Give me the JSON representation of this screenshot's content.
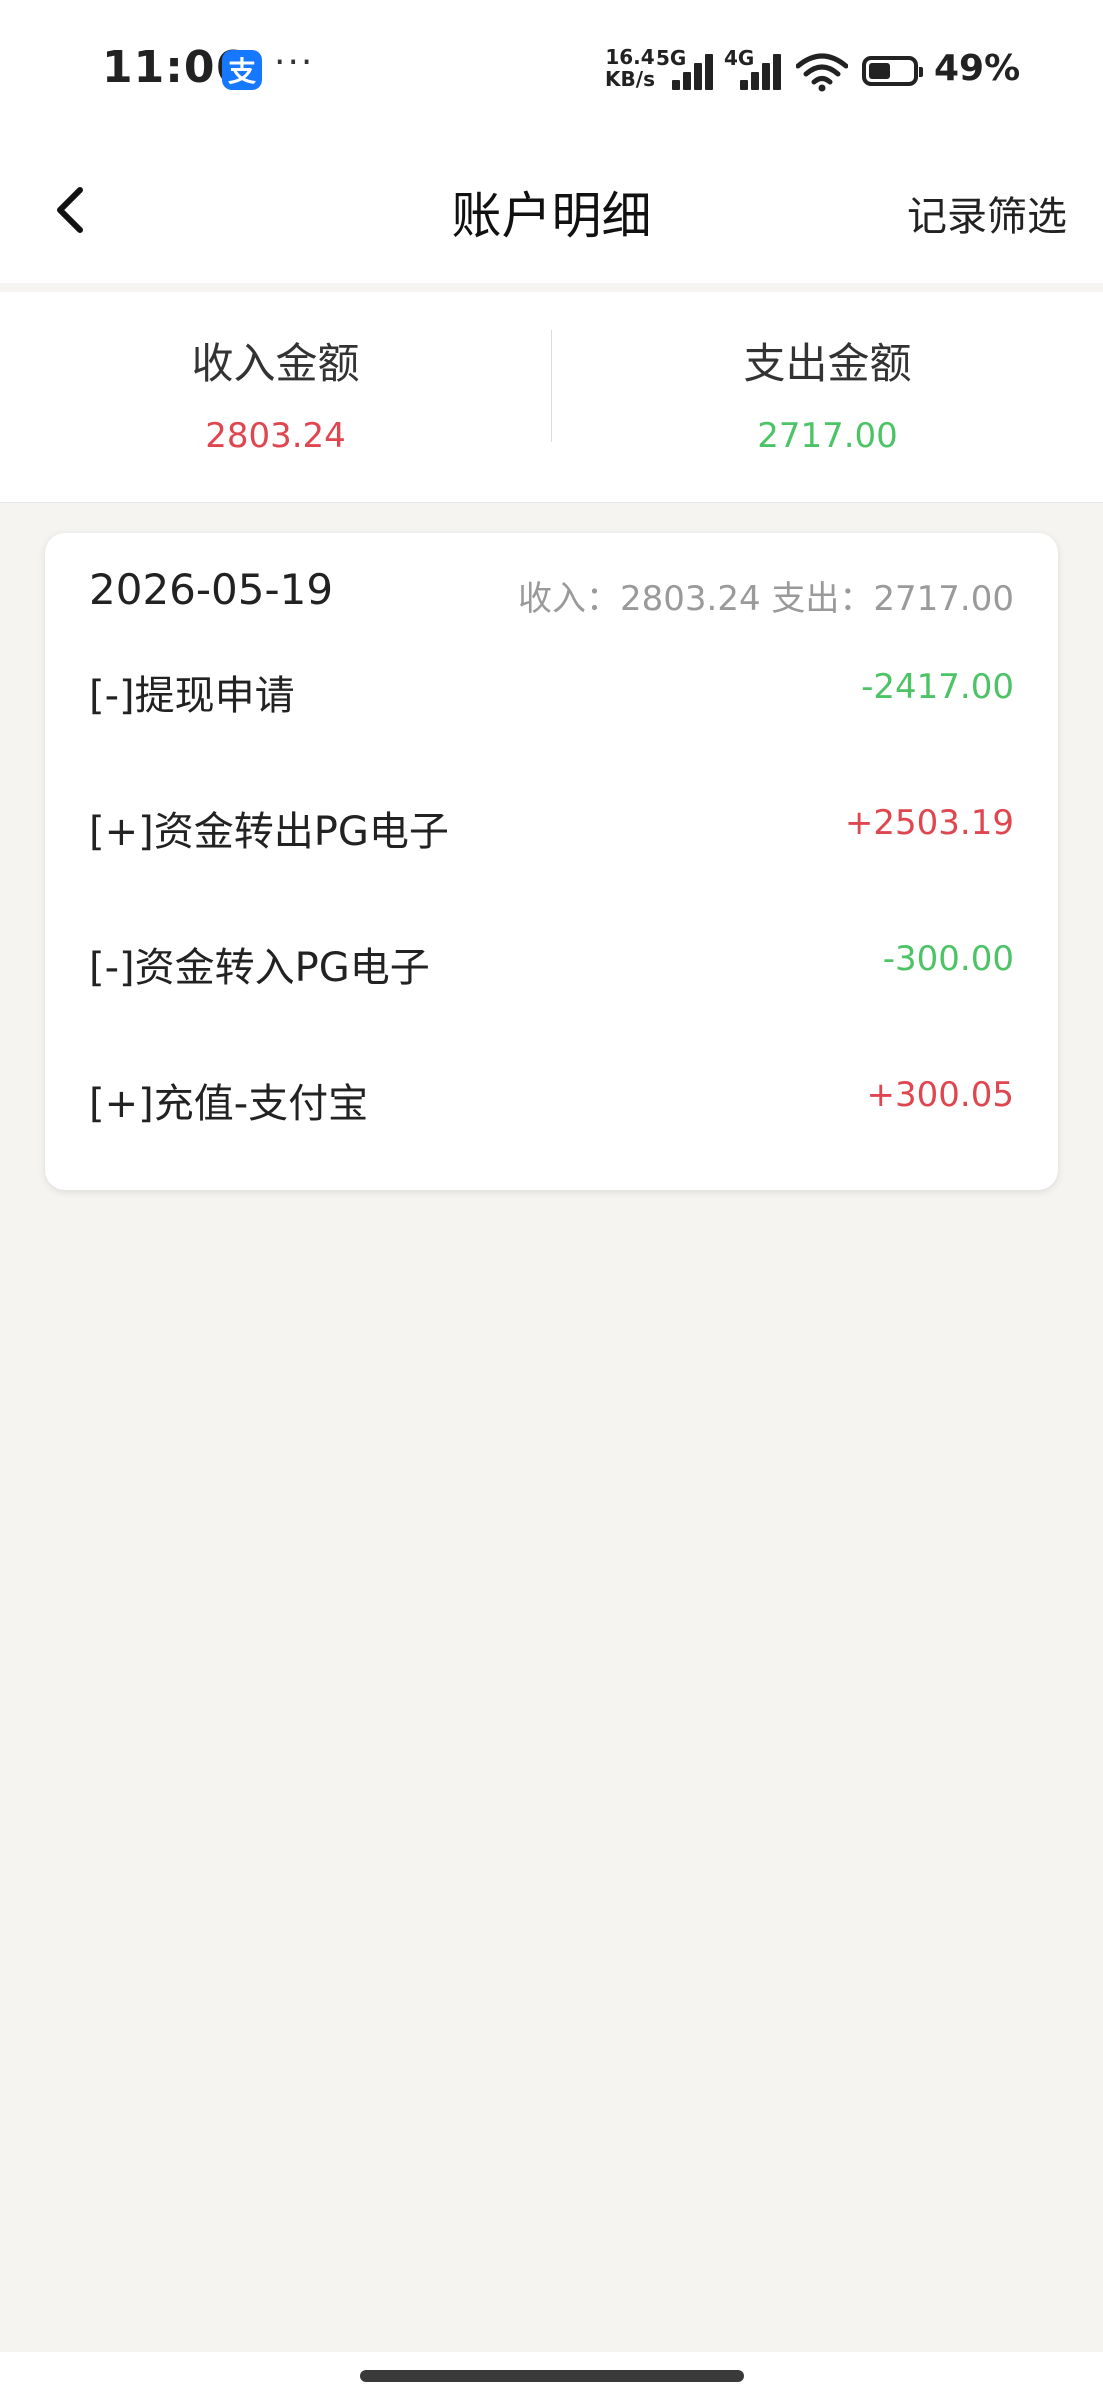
{
  "status_bar": {
    "time": "11:06",
    "alipay_badge": "支",
    "dots": "···",
    "net_speed_value": "16.4",
    "net_speed_unit": "KB/s",
    "sim1_label": "5G",
    "sim2_label": "4G",
    "battery_percent": "49%",
    "battery_level": 0.49
  },
  "nav": {
    "title": "账户明细",
    "filter_label": "记录筛选",
    "back_icon": "chevron-left-icon"
  },
  "summary": {
    "income_label": "收入金额",
    "income_value": "2803.24",
    "expense_label": "支出金额",
    "expense_value": "2717.00"
  },
  "colors": {
    "income": "#e0464f",
    "expense": "#4cc466",
    "background": "#f5f4f0"
  },
  "records": {
    "date": "2026-05-19",
    "day_summary": "收入：2803.24 支出：2717.00",
    "items": [
      {
        "title": "[-]提现申请",
        "amount": "-2417.00",
        "type": "expense"
      },
      {
        "title": "[+]资金转出PG电子",
        "amount": "+2503.19",
        "type": "income"
      },
      {
        "title": "[-]资金转入PG电子",
        "amount": "-300.00",
        "type": "expense"
      },
      {
        "title": "[+]充值-支付宝",
        "amount": "+300.05",
        "type": "income"
      }
    ]
  }
}
